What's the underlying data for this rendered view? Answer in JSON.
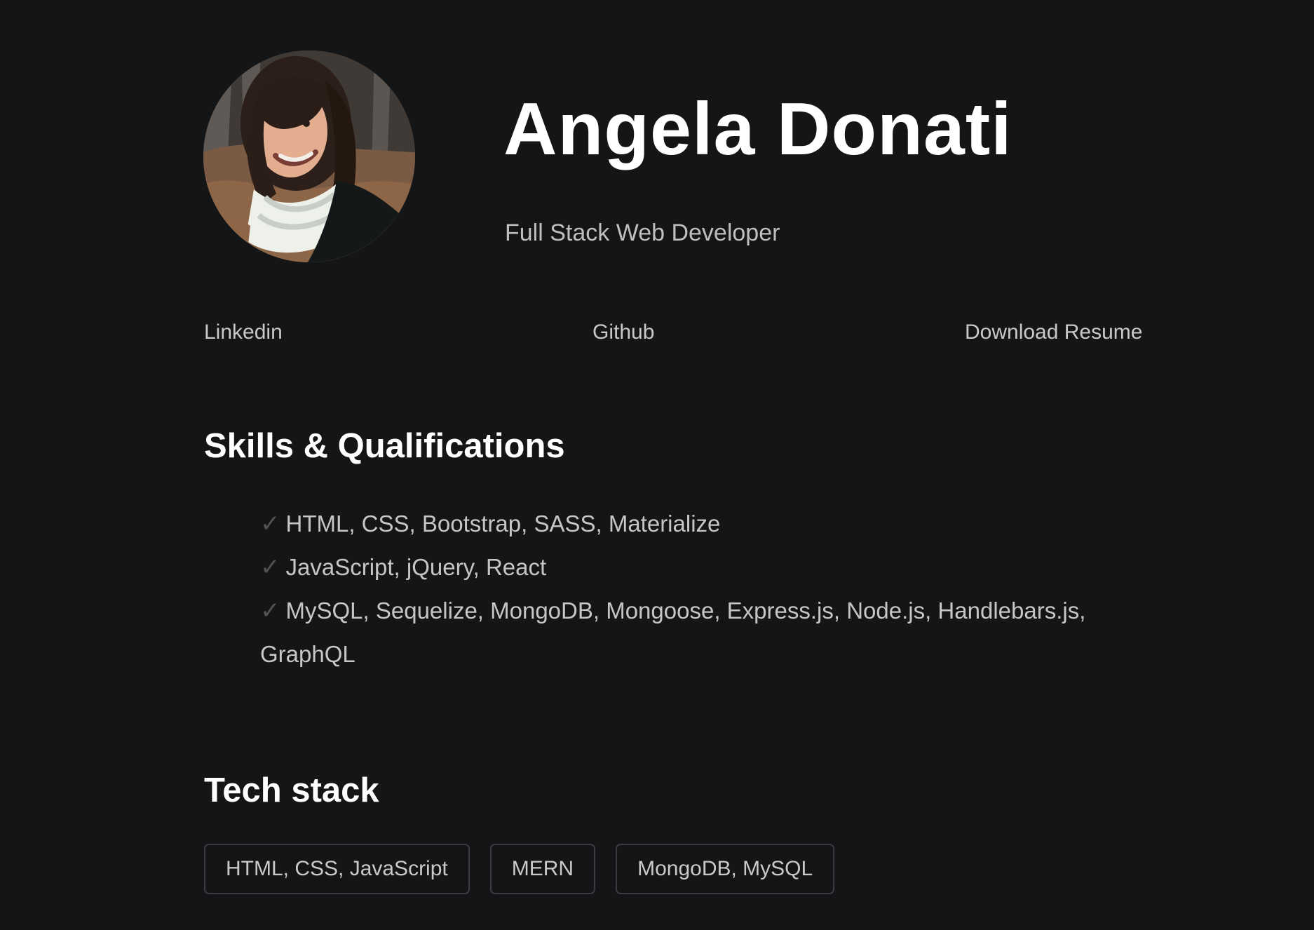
{
  "profile": {
    "name": "Angela Donati",
    "role": "Full Stack Web Developer",
    "avatar_alt": "Angela Donati"
  },
  "links": {
    "linkedin": "Linkedin",
    "github": "Github",
    "resume": "Download Resume"
  },
  "skills": {
    "title": "Skills & Qualifications",
    "check_symbol": "✓",
    "items": [
      "HTML, CSS, Bootstrap, SASS, Materialize",
      "JavaScript, jQuery, React",
      "MySQL, Sequelize, MongoDB, Mongoose, Express.js, Node.js, Handlebars.js, GraphQL"
    ]
  },
  "tech_stack": {
    "title": "Tech stack",
    "items": [
      "HTML, CSS, JavaScript",
      "MERN",
      "MongoDB, MySQL"
    ]
  },
  "colors": {
    "background": "#141516",
    "heading": "#ffffff",
    "body_text": "#c6c6c6",
    "check_mark": "#505254",
    "chip_border": "#3a3c3f"
  }
}
